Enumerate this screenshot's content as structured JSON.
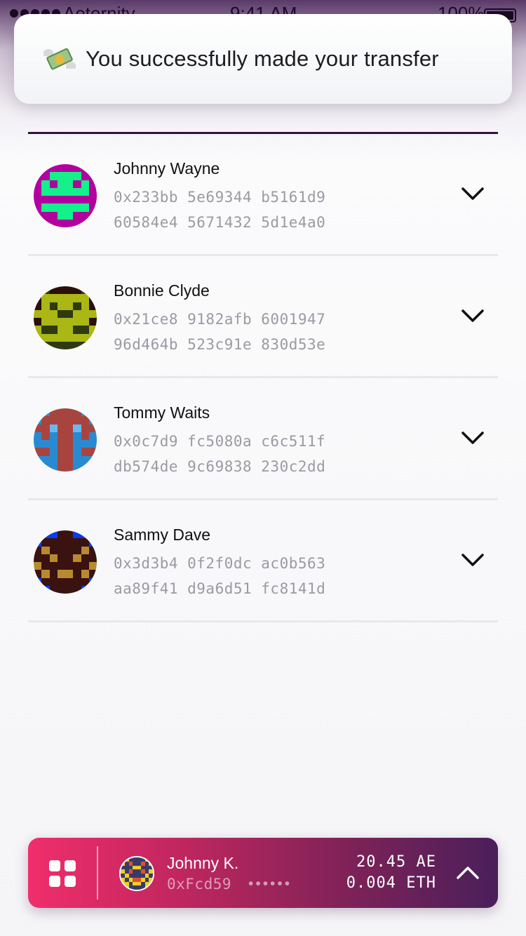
{
  "status_bar": {
    "carrier": "Aeternity",
    "time": "9:41 AM",
    "battery": "100%"
  },
  "toast": {
    "icon": "money-with-wings-icon",
    "message": "You successfully made your transfer"
  },
  "contacts": [
    {
      "name": "Johnny Wayne",
      "address_line1": "0x233bb 5e69344 b5161d9",
      "address_line2": "60584e4 5671432 5d1e4a0",
      "avatar_colors": [
        "#b2009f",
        "#14f08a"
      ]
    },
    {
      "name": "Bonnie Clyde",
      "address_line1": "0x21ce8 9182afb 6001947",
      "address_line2": "96d464b 523c91e 830d53e",
      "avatar_colors": [
        "#2a1008",
        "#aab714",
        "#2e3a10"
      ]
    },
    {
      "name": "Tommy Waits",
      "address_line1": "0x0c7d9 fc5080a c6c511f",
      "address_line2": "db574de 9c69838 230c2dd",
      "avatar_colors": [
        "#2a8ad0",
        "#a84440",
        "#6ab8f0"
      ]
    },
    {
      "name": "Sammy Dave",
      "address_line1": "0x3d3b4 0f2f0dc ac0b563",
      "address_line2": "aa89f41 d9a6d51 fc8141d",
      "avatar_colors": [
        "#0a3bf0",
        "#3a1210",
        "#b88a30"
      ]
    }
  ],
  "account": {
    "name": "Johnny K.",
    "address": "0xFcd59",
    "address_mask": "••••••",
    "balance_ae": "20.45 AE",
    "balance_eth": "0.004 ETH",
    "avatar_colors": [
      "#f0d020",
      "#3a3a6a",
      "#e05030"
    ]
  },
  "colors": {
    "accent_start": "#f02e6c",
    "accent_end": "#4a1f5a",
    "list_rule": "#33123f"
  }
}
